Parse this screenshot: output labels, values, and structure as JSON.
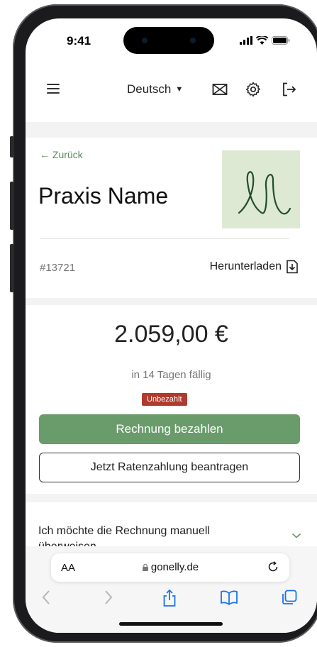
{
  "status_bar": {
    "time": "9:41"
  },
  "header": {
    "language": "Deutsch"
  },
  "nav": {
    "back_label": "← Zurück"
  },
  "practice": {
    "name": "Praxis Name"
  },
  "invoice": {
    "number": "#13721",
    "download_label": "Herunterladen",
    "amount": "2.059,00 €",
    "due_text": "in 14 Tagen fällig",
    "status_badge": "Unbezahlt",
    "pay_button": "Rechnung bezahlen",
    "installment_button": "Jetzt Ratenzahlung beantragen",
    "manual_transfer_text": "Ich möchte die Rechnung manuell",
    "manual_transfer_text_cut": "überweisen"
  },
  "browser": {
    "text_size_label": "AA",
    "url": "gonelly.de"
  },
  "colors": {
    "accent_green": "#6a9b6b",
    "logo_bg": "#dde9d3",
    "badge_red": "#b03a2e",
    "link_green": "#5a8a5e"
  },
  "icons": [
    "menu-icon",
    "caret-down-icon",
    "mail-icon",
    "gear-icon",
    "logout-icon",
    "download-icon",
    "chevron-down-icon",
    "lock-icon",
    "reload-icon",
    "back-icon",
    "forward-icon",
    "share-icon",
    "bookmarks-icon",
    "tabs-icon"
  ]
}
